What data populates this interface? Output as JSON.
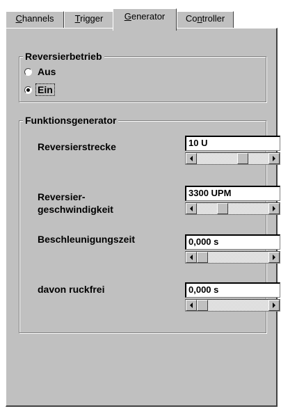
{
  "tabs": [
    {
      "label": "Channels",
      "mnemonic": "C",
      "rest": "hannels"
    },
    {
      "label": "Trigger",
      "mnemonic": "T",
      "rest": "rigger"
    },
    {
      "label": "Generator",
      "mnemonic": "G",
      "rest": "enerator",
      "active": true
    },
    {
      "label": "Controller",
      "pre": "Co",
      "mnemonic": "n",
      "rest": "troller"
    }
  ],
  "reversal_mode": {
    "title": "Reversierbetrieb",
    "options": [
      {
        "label": "Aus",
        "selected": false
      },
      {
        "label": "Ein",
        "selected": true
      }
    ]
  },
  "function_generator": {
    "title": "Funktionsgenerator",
    "fields": [
      {
        "label_line1": "Reversierstrecke",
        "label_line2": "",
        "value": "10 U",
        "slider_position": 0.55
      },
      {
        "label_line1": "Reversier-",
        "label_line2": "geschwindigkeit",
        "value": "3300 UPM",
        "slider_position": 0.45
      },
      {
        "label_line1": "Beschleunigungszeit",
        "label_line2": "",
        "value": "0,000 s",
        "slider_position": 0.0
      },
      {
        "label_line1": "davon ruckfrei",
        "label_line2": "",
        "value": "0,000 s",
        "slider_position": 0.0
      }
    ]
  },
  "colors": {
    "face": "#c0c0c0",
    "highlight": "#ffffff",
    "shadow": "#808080",
    "dark_shadow": "#404040"
  }
}
